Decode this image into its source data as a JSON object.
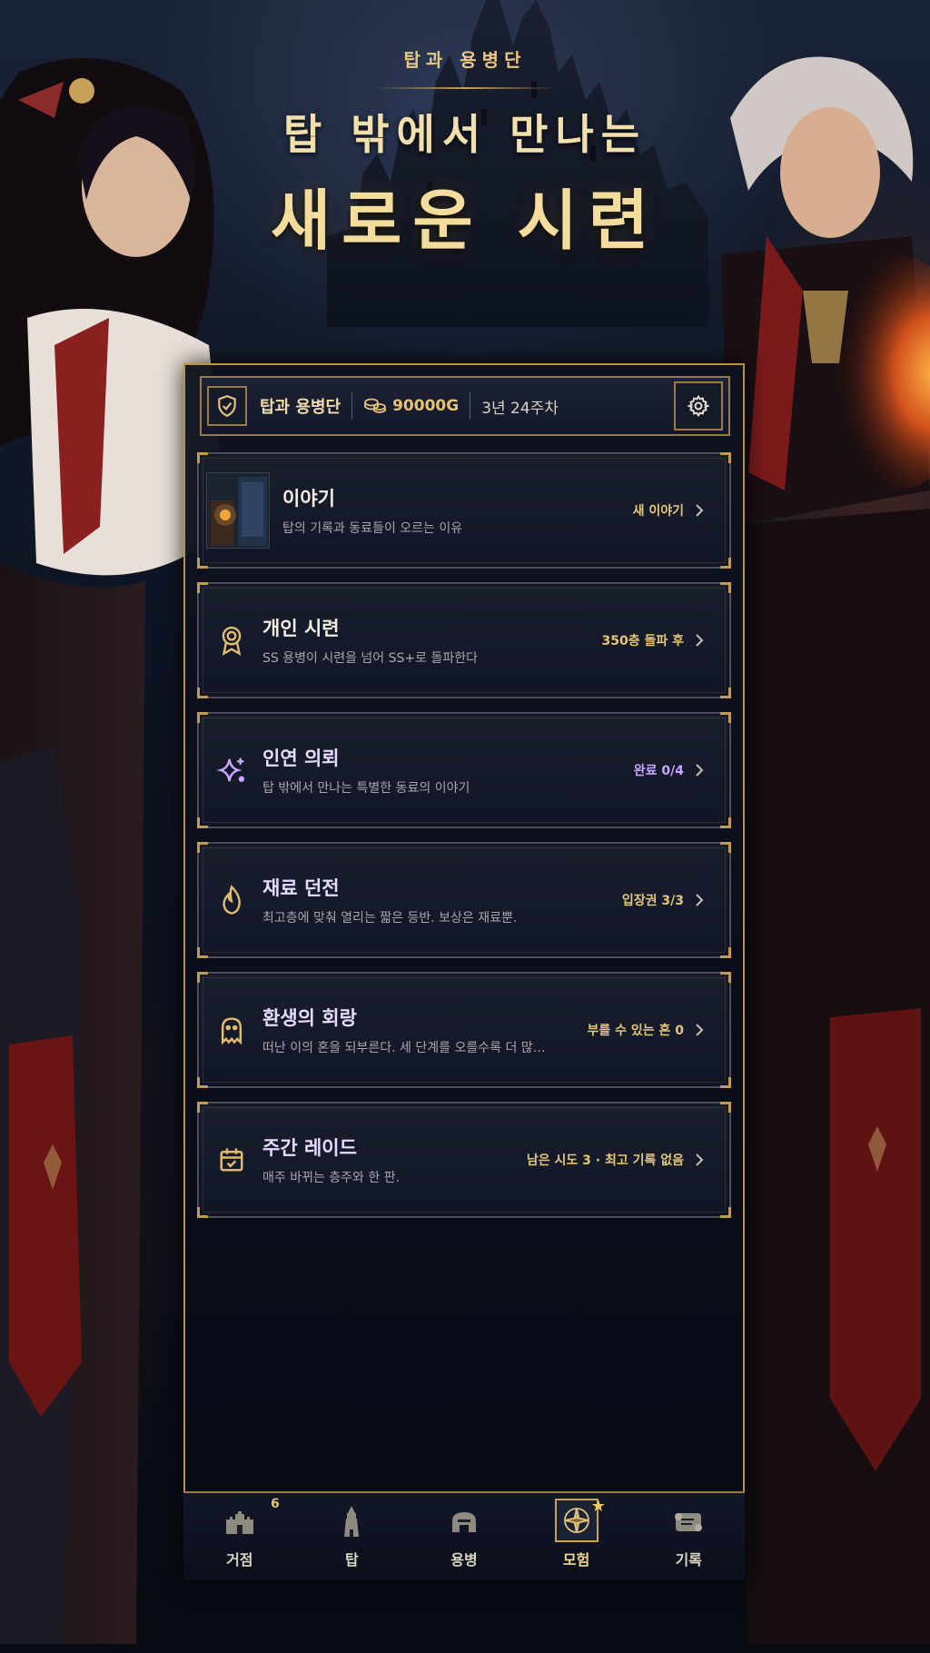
{
  "header": {
    "brand": "탑과 용병단",
    "headline_line1": "탑 밖에서 만나는",
    "headline_line2": "새로운 시련"
  },
  "topbar": {
    "shield_icon": "shield-check-icon",
    "name": "탑과 용병단",
    "gold_icon": "coin-stack-icon",
    "gold": "90000G",
    "season": "3년 24주차",
    "settings_icon": "gear-icon"
  },
  "cards": [
    {
      "title": "이야기",
      "subtitle": "탑의 기록과 동료들이 오르는 이유",
      "status": "새 이야기",
      "icon": "story-thumbnail"
    },
    {
      "title": "개인 시련",
      "subtitle": "SS 용병이 시련을 넘어 SS+로 돌파한다",
      "status": "350층 돌파 후",
      "icon": "medal-icon"
    },
    {
      "title": "인연 의뢰",
      "subtitle": "탑 밖에서 만나는 특별한 동료의 이야기",
      "status": "완료 0/4",
      "icon": "sparkle-icon",
      "accent": "violet"
    },
    {
      "title": "재료 던전",
      "subtitle": "최고층에 맞춰 열리는 짧은 등반. 보상은 재료뿐.",
      "status": "입장권 3/3",
      "icon": "flame-icon"
    },
    {
      "title": "환생의 회랑",
      "subtitle": "떠난 이의 혼을 되부른다. 세 단계를 오를수록 더 많…",
      "status": "부를 수 있는 혼 0",
      "icon": "ghost-icon"
    },
    {
      "title": "주간 레이드",
      "subtitle": "매주 바뀌는 층주와 한 판.",
      "status": "남은 시도 3 · 최고 기록 없음",
      "icon": "calendar-check-icon"
    }
  ],
  "nav": [
    {
      "label": "거점",
      "badge": "6",
      "icon": "castle-icon"
    },
    {
      "label": "탑",
      "icon": "tower-icon"
    },
    {
      "label": "용병",
      "icon": "helmet-icon"
    },
    {
      "label": "모험",
      "icon": "compass-icon",
      "active": true
    },
    {
      "label": "기록",
      "icon": "scroll-icon"
    }
  ],
  "colors": {
    "gold_accent": "#c9a25a",
    "status_gold": "#e5c679",
    "status_violet": "#c9a6ff",
    "background": "#0c1220"
  }
}
